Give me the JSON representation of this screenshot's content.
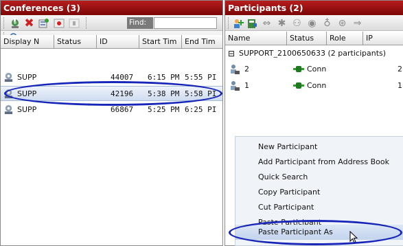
{
  "conferences": {
    "title": "Conferences (3)",
    "find_label": "Find:",
    "find_value": "",
    "columns": [
      "Display N",
      "Status",
      "ID",
      "Start Tim",
      "End Tim"
    ],
    "rows": [
      {
        "name": "SUPP",
        "status": "",
        "id": "44007",
        "start": "6:15 PM",
        "end": "5:55 PI",
        "selected": false
      },
      {
        "name": "SUPP",
        "status": "",
        "id": "42196",
        "start": "5:38 PM",
        "end": "5:58 PI",
        "selected": true
      },
      {
        "name": "SUPP",
        "status": "",
        "id": "66867",
        "start": "5:25 PM",
        "end": "6:25 PI",
        "selected": false
      }
    ]
  },
  "participants": {
    "title": "Participants (2)",
    "columns": [
      "Name",
      "Status",
      "Role",
      "IP"
    ],
    "group_label": "SUPPORT_2100650633 (2 participants)",
    "group_toggle": "⊟",
    "rows": [
      {
        "name": "2",
        "status": "Conn",
        "ip": "2"
      },
      {
        "name": "1",
        "status": "Conn",
        "ip": "1"
      }
    ]
  },
  "context_menu": {
    "items": [
      "New Participant",
      "Add Participant from Address Book",
      "Quick Search",
      "Copy Participant",
      "Cut Participant",
      "Paste Participant",
      "Paste Participant As"
    ]
  },
  "colors": {
    "title_bar": "#9b0f0f",
    "highlight_ellipse": "#1726b8",
    "selected_row": "#d6e1f2",
    "menu_background": "#f0f3f8"
  }
}
